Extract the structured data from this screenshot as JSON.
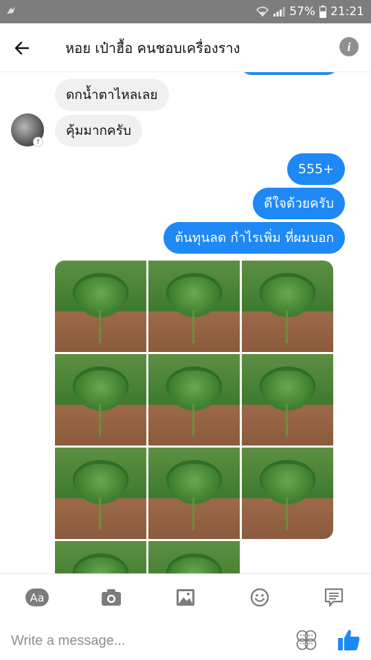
{
  "status_bar": {
    "battery": "57%",
    "time": "21:21",
    "icons": [
      "notification-icon",
      "wifi-icon",
      "signal-icon",
      "battery-icon"
    ]
  },
  "header": {
    "title": "หอย เป๋าฮื้อ คนชอบเครื่องราง",
    "back_icon": "back-arrow-icon",
    "info_icon": "info-icon"
  },
  "messages": [
    {
      "side": "in",
      "text": "ดกน้ำตาไหลเลย"
    },
    {
      "side": "in",
      "text": "คุ้มมากครับ"
    },
    {
      "side": "out",
      "text": "555+"
    },
    {
      "side": "out",
      "text": "ดีใจด้วยครับ"
    },
    {
      "side": "out",
      "text": "ต้นทุนลด กำไรเพิ่ม ที่ผมบอก"
    }
  ],
  "gallery": {
    "image_count": 11,
    "subject": "chili pepper plants"
  },
  "composer": {
    "placeholder": "Write a message...",
    "tools": [
      "text-format-icon",
      "camera-icon",
      "image-icon",
      "emoji-icon",
      "message-bubble-icon"
    ],
    "sticker_icon": "sticker-icon",
    "like_icon": "thumbs-up-icon"
  },
  "colors": {
    "status_bar": "#7d7d7d",
    "outgoing_bubble": "#1e88f5",
    "incoming_bubble": "#f0f0f0",
    "like_blue": "#1e88f5",
    "icon_gray": "#7c7c7c"
  }
}
